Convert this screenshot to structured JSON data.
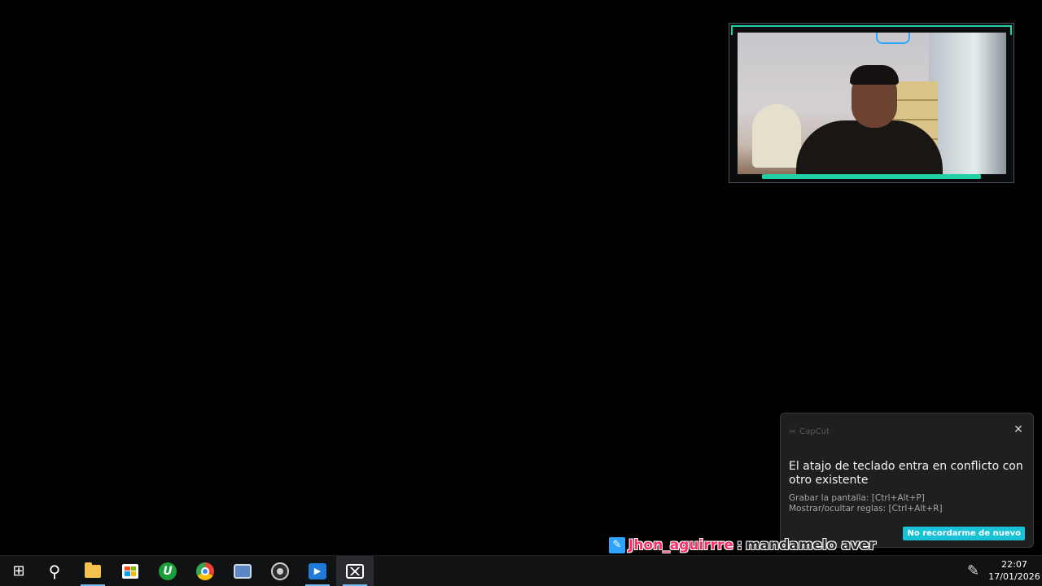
{
  "webcam": {},
  "toast": {
    "app_name": "CapCut",
    "close_icon": "close-icon",
    "title": "El atajo de teclado entra en conflicto con otro existente",
    "line1": "Grabar la pantalla: [Ctrl+Alt+P]",
    "line2": "Mostrar/ocultar reglas: [Ctrl+Alt+R]",
    "button_label": "No recordarme de nuevo",
    "button_color": "#19c1d6"
  },
  "chat": {
    "username": "Jhon_aguirrre",
    "separator": ":",
    "message": "mandamelo aver",
    "username_color": "#ff2d63"
  },
  "taskbar": {
    "items": [
      {
        "name": "start-icon",
        "state": "idle"
      },
      {
        "name": "search-icon",
        "state": "idle"
      },
      {
        "name": "file-explorer-icon",
        "state": "running"
      },
      {
        "name": "microsoft-store-icon",
        "state": "idle"
      },
      {
        "name": "u-app-icon",
        "state": "idle"
      },
      {
        "name": "chrome-icon",
        "state": "idle"
      },
      {
        "name": "app-window-icon",
        "state": "idle"
      },
      {
        "name": "obs-icon",
        "state": "idle"
      },
      {
        "name": "media-player-icon",
        "state": "running"
      },
      {
        "name": "capcut-icon",
        "state": "active"
      }
    ],
    "tray_icon": "pen-icon",
    "clock": {
      "time": "22:07",
      "date": "17/01/2026"
    }
  }
}
